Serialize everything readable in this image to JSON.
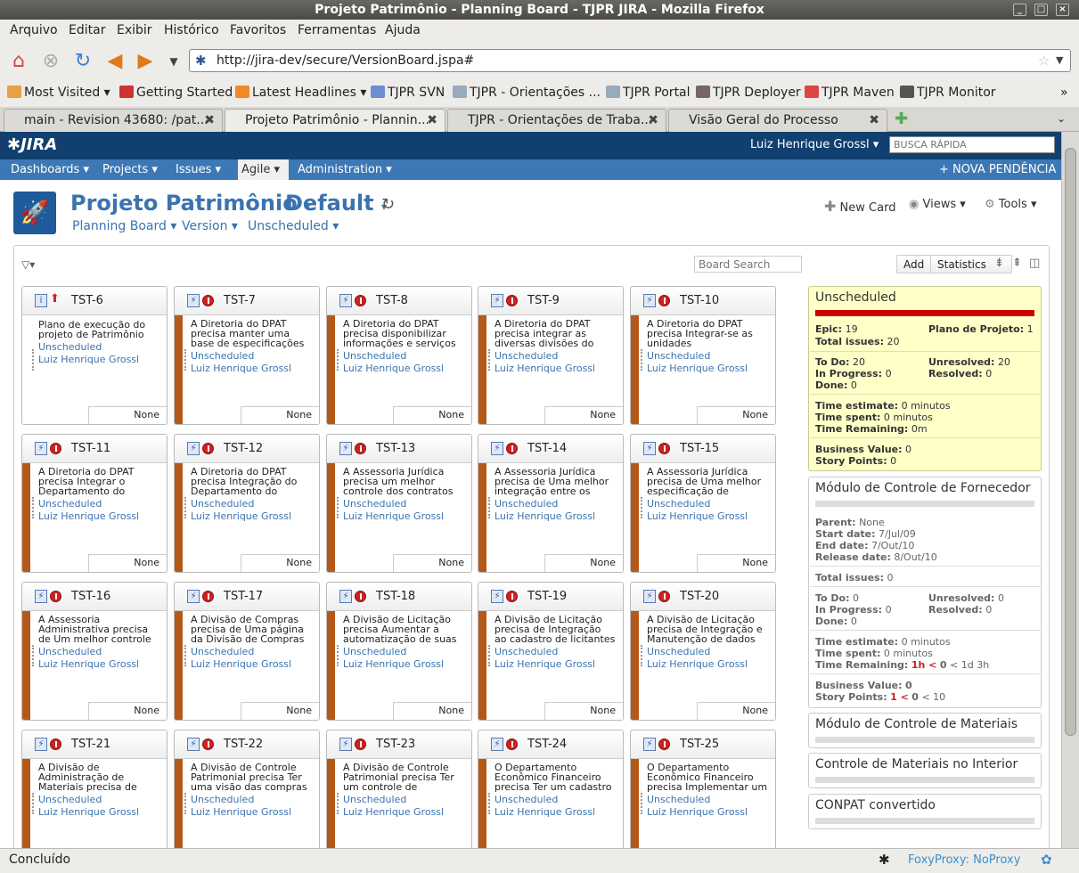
{
  "window": {
    "title": "Projeto Patrimônio - Planning Board - TJPR JIRA - Mozilla Firefox"
  },
  "menu": [
    "Arquivo",
    "Editar",
    "Exibir",
    "Histórico",
    "Favoritos",
    "Ferramentas",
    "Ajuda"
  ],
  "url": "http://jira-dev/secure/VersionBoard.jspa#",
  "bookmarks": [
    "Most Visited",
    "Getting Started",
    "Latest Headlines",
    "TJPR SVN",
    "TJPR - Orientações ...",
    "TJPR Portal",
    "TJPR Deployer",
    "TJPR Maven",
    "TJPR Monitor"
  ],
  "tabs": [
    "main - Revision 43680: /pat...",
    "Projeto Patrimônio - Plannin...",
    "TJPR - Orientações de Traba...",
    "Visão Geral do Processo"
  ],
  "jira": {
    "logo": "JIRA",
    "user": "Luiz Henrique Grossl",
    "search_placeholder": "BUSCA RÁPIDA",
    "nav": [
      "Dashboards",
      "Projects",
      "Issues",
      "Agile",
      "Administration"
    ],
    "new_issue": "NOVA PENDÊNCIA",
    "project": "Projeto Patrimônio",
    "board": "Default",
    "sub": [
      "Planning Board",
      "Version",
      "Unscheduled"
    ],
    "actions": {
      "new_card": "New Card",
      "views": "Views",
      "tools": "Tools"
    },
    "board_search": "Board Search",
    "add": "Add",
    "statistics": "Statistics"
  },
  "cards": [
    {
      "key": "TST-6",
      "summary": "Plano de execução do projeto de Patrimônio",
      "type": "task"
    },
    {
      "key": "TST-7",
      "summary": "A Diretoria do DPAT precisa manter uma base de especificações de",
      "type": "bug"
    },
    {
      "key": "TST-8",
      "summary": "A Diretoria do DPAT precisa disponibilizar informações e serviços",
      "type": "bug"
    },
    {
      "key": "TST-9",
      "summary": "A Diretoria do DPAT precisa integrar as diversas divisões do",
      "type": "bug"
    },
    {
      "key": "TST-10",
      "summary": "A Diretoria do DPAT precisa Integrar-se as unidades especializadas,",
      "type": "bug"
    },
    {
      "key": "TST-11",
      "summary": "A Diretoria do DPAT precisa Integrar o Departamento do",
      "type": "bug"
    },
    {
      "key": "TST-12",
      "summary": "A Diretoria do DPAT precisa Integração do Departamento do",
      "type": "bug"
    },
    {
      "key": "TST-13",
      "summary": "A Assessoria Jurídica precisa um melhor controle dos contratos",
      "type": "bug"
    },
    {
      "key": "TST-14",
      "summary": "A Assessoria Jurídica precisa de Uma melhor integração entre os",
      "type": "bug"
    },
    {
      "key": "TST-15",
      "summary": "A Assessoria Jurídica precisa de Uma melhor especificação de",
      "type": "bug"
    },
    {
      "key": "TST-16",
      "summary": "A Assessoria Administrativa precisa de Um melhor controle dos",
      "type": "bug"
    },
    {
      "key": "TST-17",
      "summary": "A Divisão de Compras precisa de Uma página da Divisão de Compras",
      "type": "bug"
    },
    {
      "key": "TST-18",
      "summary": "A Divisão de Licitação precisa Aumentar a automatização de suas",
      "type": "bug"
    },
    {
      "key": "TST-19",
      "summary": "A Divisão de Licitação precisa de Integração ao cadastro de licitantes do",
      "type": "bug"
    },
    {
      "key": "TST-20",
      "summary": "A Divisão de Licitação precisa de Integração e Manutenção de dados",
      "type": "bug"
    },
    {
      "key": "TST-21",
      "summary": "A Divisão de Administração de Materiais precisa de uma",
      "type": "bug"
    },
    {
      "key": "TST-22",
      "summary": "A Divisão de Controle Patrimonial precisa Ter uma visão das compras",
      "type": "bug"
    },
    {
      "key": "TST-23",
      "summary": "A Divisão de Controle Patrimonial precisa Ter um controle de",
      "type": "bug"
    },
    {
      "key": "TST-24",
      "summary": "O Departamento Econômico Financeiro precisa Ter um cadastro",
      "type": "bug"
    },
    {
      "key": "TST-25",
      "summary": "O Departamento Econômico Financeiro precisa Implementar um",
      "type": "bug"
    }
  ],
  "card_common": {
    "version": "Unscheduled",
    "assignee": "Luiz Henrique Grossl",
    "estimate": "None"
  },
  "panels": {
    "unscheduled": {
      "title": "Unscheduled",
      "epic_label": "Epic:",
      "epic": "19",
      "plano_label": "Plano de Projeto:",
      "plano": "1",
      "total_label": "Total issues:",
      "total": "20",
      "todo_label": "To Do:",
      "todo": "20",
      "unresolved_label": "Unresolved:",
      "unresolved": "20",
      "inprogress_label": "In Progress:",
      "inprogress": "0",
      "resolved_label": "Resolved:",
      "resolved": "0",
      "done_label": "Done:",
      "done": "0",
      "te_label": "Time estimate:",
      "te": "0 minutos",
      "ts_label": "Time spent:",
      "ts": "0 minutos",
      "tr_label": "Time Remaining:",
      "tr": "0m",
      "bv_label": "Business Value:",
      "bv": "0",
      "sp_label": "Story Points:",
      "sp": "0"
    },
    "fornecedor": {
      "title": "Módulo de Controle de Fornecedor",
      "parent_label": "Parent:",
      "parent": "None",
      "start_label": "Start date:",
      "start": "7/Jul/09",
      "end_label": "End date:",
      "end": "7/Out/10",
      "release_label": "Release date:",
      "release": "8/Out/10",
      "total_label": "Total issues:",
      "total": "0",
      "todo_label": "To Do:",
      "todo": "0",
      "unresolved_label": "Unresolved:",
      "unresolved": "0",
      "inprogress_label": "In Progress:",
      "inprogress": "0",
      "resolved_label": "Resolved:",
      "resolved": "0",
      "done_label": "Done:",
      "done": "0",
      "te_label": "Time estimate:",
      "te": "0 minutos",
      "ts_label": "Time spent:",
      "ts": "0 minutos",
      "tr_label": "Time Remaining:",
      "tr_red": "1h <",
      "tr_b": "0",
      "tr_rest": "< 1d 3h",
      "bv_label": "Business Value:",
      "bv": "0",
      "sp_label": "Story Points:",
      "sp_red": "1 <",
      "sp_b": "0",
      "sp_rest": "< 10"
    },
    "others": [
      "Módulo de Controle de Materiais",
      "Controle de Materiais no Interior",
      "CONPAT convertido"
    ]
  },
  "status": {
    "left": "Concluído",
    "right": "FoxyProxy: NoProxy"
  }
}
